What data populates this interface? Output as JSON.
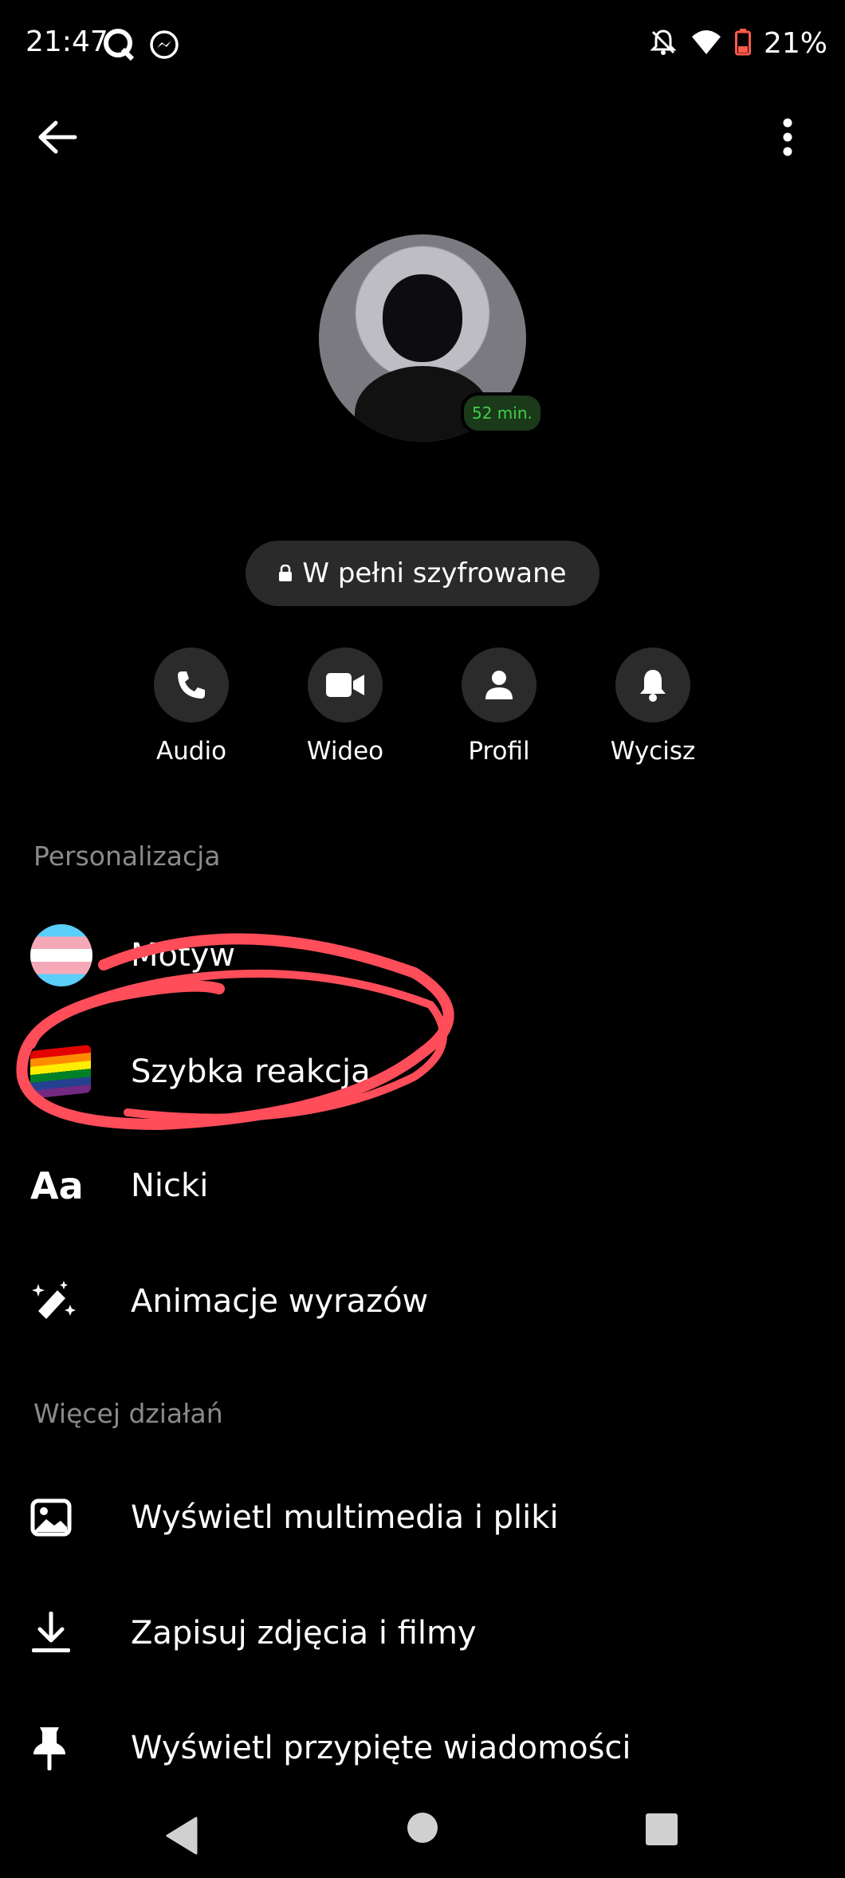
{
  "status_bar": {
    "time": "21:47",
    "battery": "21%",
    "icons": [
      "q-app-icon",
      "messenger-icon",
      "bell-off-icon",
      "wifi-icon",
      "battery-icon"
    ]
  },
  "header": {
    "back_icon": "arrow-left-icon",
    "more_icon": "more-vertical-icon"
  },
  "profile": {
    "presence": "52 min."
  },
  "encryption": {
    "label": "W pełni szyfrowane"
  },
  "actions": [
    {
      "label": "Audio",
      "icon": "phone-icon"
    },
    {
      "label": "Wideo",
      "icon": "video-icon"
    },
    {
      "label": "Profil",
      "icon": "person-icon"
    },
    {
      "label": "Wycisz",
      "icon": "bell-icon"
    }
  ],
  "personalization": {
    "title": "Personalizacja",
    "items": [
      {
        "label": "Motyw",
        "icon": "theme-icon"
      },
      {
        "label": "Szybka reakcja",
        "icon": "rainbow-flag-icon"
      },
      {
        "label": "Nicki",
        "icon": "text-aa-icon"
      },
      {
        "label": "Animacje wyrazów",
        "icon": "magic-wand-icon"
      }
    ]
  },
  "more_actions": {
    "title": "Więcej działań",
    "items": [
      {
        "label": "Wyświetl multimedia i pliki",
        "icon": "image-icon"
      },
      {
        "label": "Zapisuj zdjęcia i filmy",
        "icon": "download-icon"
      },
      {
        "label": "Wyświetl przypięte wiadomości",
        "icon": "pin-icon"
      }
    ]
  },
  "colors": {
    "background": "#000000",
    "annotation": "#ff4d5a",
    "presence": "#3fcf4a"
  }
}
